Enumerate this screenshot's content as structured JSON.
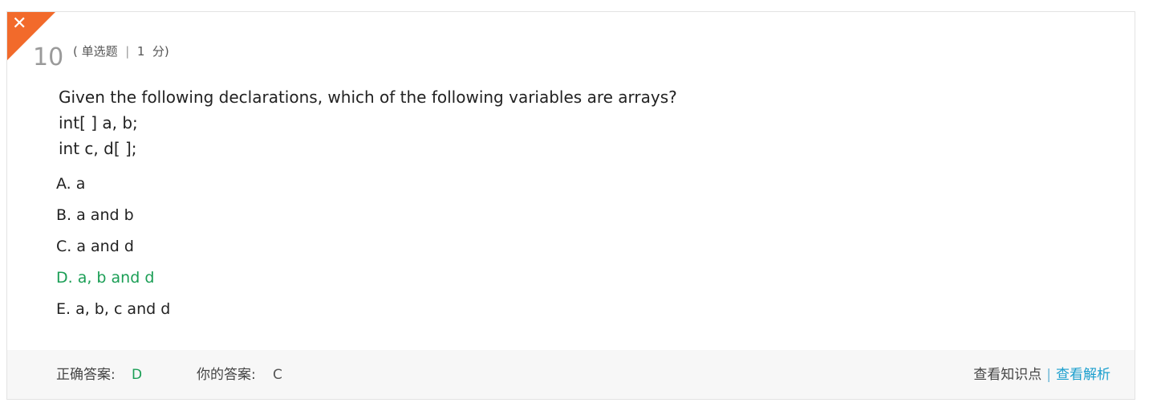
{
  "question": {
    "number": "10",
    "meta": {
      "open_paren": "(",
      "type": "单选题",
      "divider": "|",
      "score_value": "1",
      "score_unit": "分)",
      "accent_color": "#f26a2b"
    },
    "stem_lines": [
      "Given the following declarations, which of the following variables are arrays?",
      "int[ ] a, b;",
      "int c, d[ ];"
    ],
    "options": [
      {
        "text": "A. a",
        "correct": false
      },
      {
        "text": "B. a and b",
        "correct": false
      },
      {
        "text": "C. a and d",
        "correct": false
      },
      {
        "text": "D. a, b and d",
        "correct": true
      },
      {
        "text": "E. a, b, c and d",
        "correct": false
      }
    ],
    "status_icon": "close-icon",
    "status": "incorrect"
  },
  "footer": {
    "correct_label": "正确答案:",
    "correct_value": "D",
    "your_label": "你的答案:",
    "your_value": "C",
    "view_knowledge": "查看知识点",
    "link_divider": "|",
    "view_analysis": "查看解析"
  },
  "colors": {
    "correct": "#1a9e55",
    "link": "#1b9fce",
    "corner": "#f26a2b"
  }
}
